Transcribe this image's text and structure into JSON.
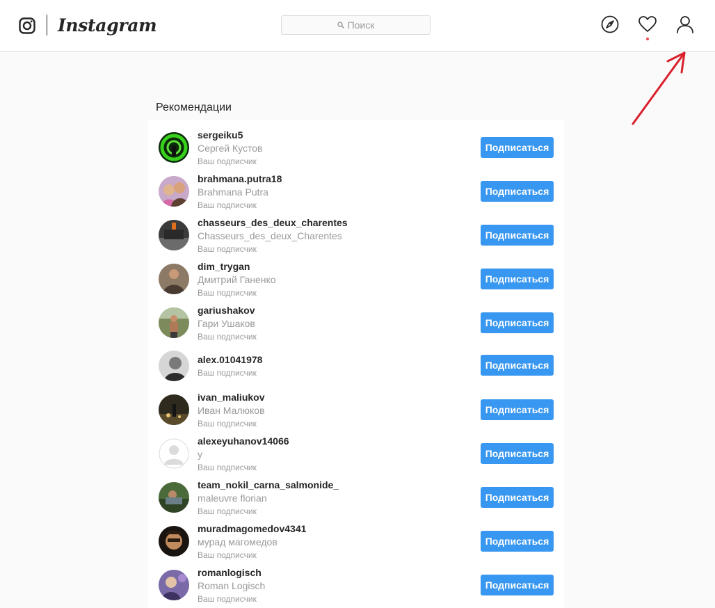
{
  "header": {
    "wordmark": "Instagram",
    "search_placeholder": "Поиск",
    "icons": [
      "instagram-glyph-icon",
      "explore-compass-icon",
      "activity-heart-icon",
      "profile-icon"
    ],
    "notification_dot_color": "#ed4956",
    "annotation_arrow_color": "#d9202b"
  },
  "suggestions": {
    "title": "Рекомендации",
    "follow_label": "Подписаться",
    "button_color": "#3897f0",
    "items": [
      {
        "username": "sergeiku5",
        "full_name": "Сергей Кустов",
        "status": "Ваш подписчик"
      },
      {
        "username": "brahmana.putra18",
        "full_name": "Brahmana Putra",
        "status": "Ваш подписчик"
      },
      {
        "username": "chasseurs_des_deux_charentes",
        "full_name": "Chasseurs_des_deux_Charentes",
        "status": "Ваш подписчик"
      },
      {
        "username": "dim_trygan",
        "full_name": "Дмитрий Ганенко",
        "status": "Ваш подписчик"
      },
      {
        "username": "gariushakov",
        "full_name": "Гари Ушаков",
        "status": "Ваш подписчик"
      },
      {
        "username": "alex.01041978",
        "full_name": "",
        "status": "Ваш подписчик"
      },
      {
        "username": "ivan_maliukov",
        "full_name": "Иван Малюков",
        "status": "Ваш подписчик"
      },
      {
        "username": "alexeyuhanov14066",
        "full_name": "у",
        "status": "Ваш подписчик"
      },
      {
        "username": "team_nokil_carna_salmonide_",
        "full_name": "maleuvre florian",
        "status": "Ваш подписчик"
      },
      {
        "username": "muradmagomedov4341",
        "full_name": "мурад магомедов",
        "status": "Ваш подписчик"
      },
      {
        "username": "romanlogisch",
        "full_name": "Roman Logisch",
        "status": "Ваш подписчик"
      }
    ]
  }
}
